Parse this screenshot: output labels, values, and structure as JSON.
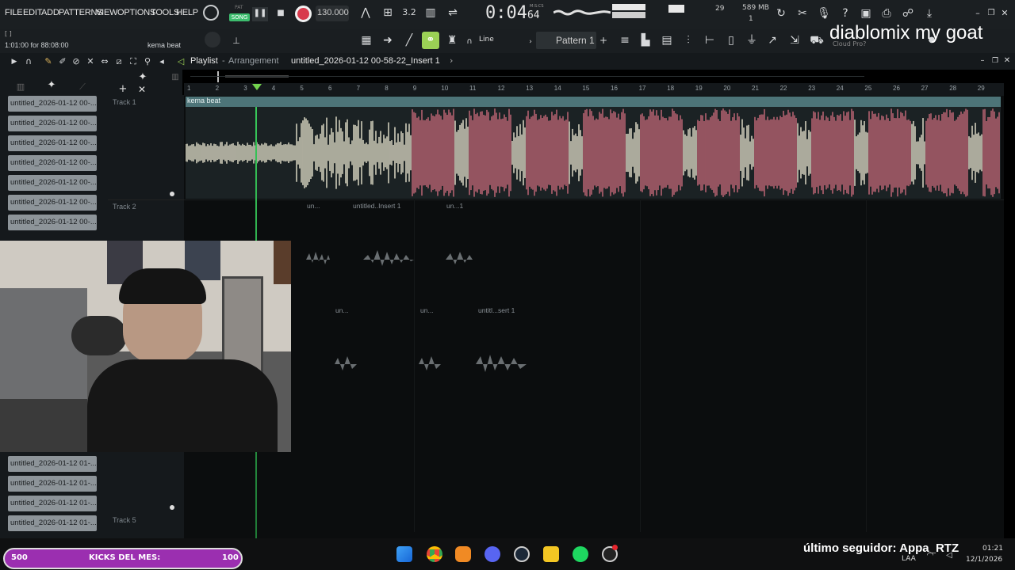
{
  "menu": [
    "FILE",
    "EDIT",
    "ADD",
    "PATTERNS",
    "VIEW",
    "OPTIONS",
    "TOOLS",
    "HELP"
  ],
  "transport": {
    "pat_label": "PAT",
    "song_label": "SONG",
    "tempo": "130.000",
    "time": "0:04",
    "time_sub": "64",
    "time_unit_label": "M:S:CS",
    "memory": "589 MB",
    "cpu": "29",
    "voices": "1"
  },
  "hint": {
    "position": "1:01:00 for 88:08:00",
    "bracket": "[ ]",
    "beat_name": "kema beat"
  },
  "toolbar2": {
    "snap_label": "Line",
    "pattern_label": "Pattern 1",
    "cloud_label": "Cloud Pro?"
  },
  "overlay_title": "diablomix my goat",
  "playlist": {
    "title": "Playlist",
    "separator": "-",
    "subtitle": "Arrangement",
    "arrangement_name": "untitled_2026-01-12 00-58-22_Insert 1",
    "arrow": "›"
  },
  "ruler_ticks": [
    "1",
    "2",
    "3",
    "4",
    "5",
    "6",
    "7",
    "8",
    "9",
    "10",
    "11",
    "12",
    "13",
    "14",
    "15",
    "16",
    "17",
    "18",
    "19",
    "20",
    "21",
    "22",
    "23",
    "24",
    "25",
    "26",
    "27",
    "28",
    "29"
  ],
  "patterns": [
    "untitled_2026-01-12 00-...",
    "untitled_2026-01-12 00-...",
    "untitled_2026-01-12 00-...",
    "untitled_2026-01-12 00-...",
    "untitled_2026-01-12 00-...",
    "untitled_2026-01-12 00-...",
    "untitled_2026-01-12 00-..."
  ],
  "patterns_bottom": [
    "untitled_2026-01-12 01-...",
    "untitled_2026-01-12 01-...",
    "untitled_2026-01-12 01-...",
    "untitled_2026-01-12 01-..."
  ],
  "tracks": {
    "t1": "Track 1",
    "t2": "Track 2",
    "t5": "Track 5"
  },
  "clip1_label": "kema beat",
  "mini_clips_row1": [
    "un...",
    "untitled..Insert 1",
    "un...1"
  ],
  "mini_clips_row2": [
    "un...",
    "un...",
    "untitl...sert 1"
  ],
  "stream": {
    "kicks_left": "500",
    "kicks_label": "KICKS DEL MES:",
    "kicks_right": "100",
    "follower": "último seguidor: Appa_RTZ"
  },
  "tray": {
    "lang": "LAA",
    "time": "01:21",
    "date": "12/1/2026"
  },
  "colors": {
    "accent": "#c96a7a",
    "waveform_light": "#e9e5cf",
    "clip_header": "#4d7478",
    "playhead": "#38c95a",
    "kicks_bar": "#9b2fb0"
  }
}
